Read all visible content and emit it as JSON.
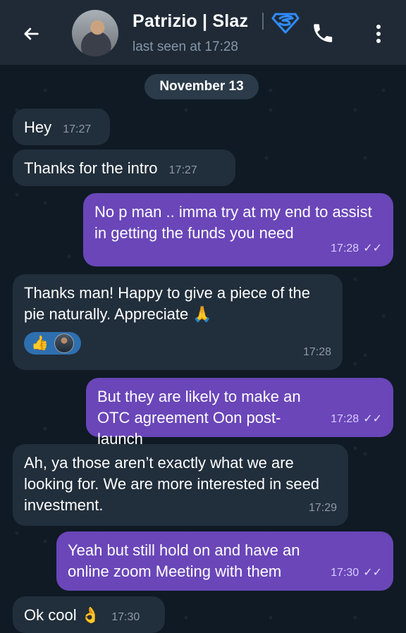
{
  "header": {
    "back_icon": "arrow-left-icon",
    "name": "Patrizio | Slaz",
    "status": "last seen at 17:28",
    "badge_icon": "superman-shield-icon",
    "call_icon": "phone-icon",
    "more_icon": "more-vertical-icon"
  },
  "date_chip": "November 13",
  "messages": [
    {
      "direction": "in",
      "text": "Hey",
      "time": "17:27"
    },
    {
      "direction": "in",
      "text": "Thanks for the intro",
      "time": "17:27"
    },
    {
      "direction": "out",
      "text": "No p man .. imma try at my end to assist in getting the funds you need",
      "time": "17:28",
      "ticks": "✓✓"
    },
    {
      "direction": "in",
      "text": "Thanks man! Happy to give a piece of the pie naturally. Appreciate 🙏",
      "time": "17:28",
      "reaction": {
        "emoji": "👍",
        "avatar_icon": "reactor-avatar-icon"
      }
    },
    {
      "direction": "out",
      "text": "But they are likely to make an OTC agreement Oon post-launch",
      "time": "17:28",
      "ticks": "✓✓"
    },
    {
      "direction": "in",
      "text": "Ah, ya those aren’t exactly what we are looking for. We are more interested in seed investment.",
      "time": "17:29"
    },
    {
      "direction": "out",
      "text": "Yeah but still hold on and have an online zoom Meeting with them",
      "time": "17:30",
      "ticks": "✓✓"
    },
    {
      "direction": "in",
      "text": "Ok cool 👌",
      "time": "17:30"
    }
  ],
  "colors": {
    "background": "#0f1a24",
    "header": "#1f2a36",
    "incoming": "#212e3b",
    "outgoing": "#6a46b9",
    "reaction": "#2e6fb0"
  }
}
